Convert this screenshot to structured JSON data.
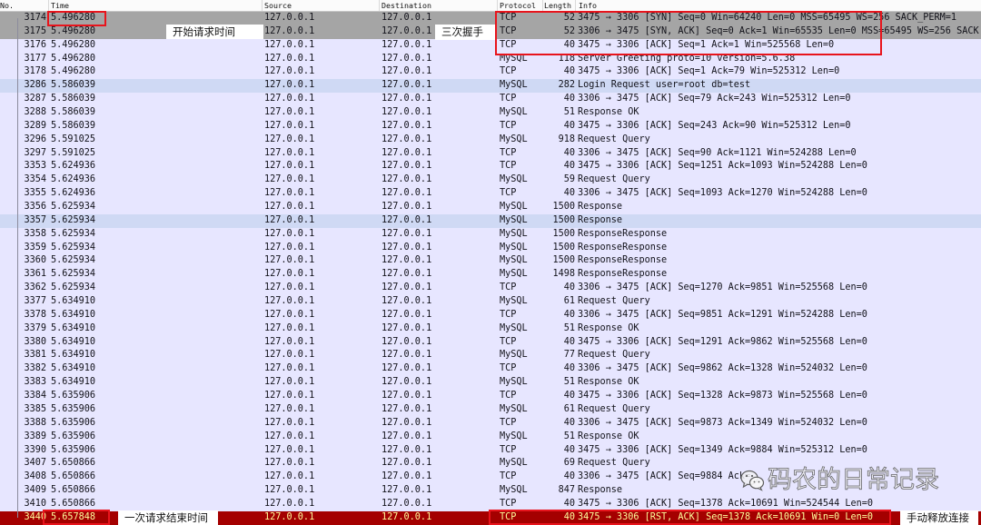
{
  "columns": {
    "no": "No.",
    "time": "Time",
    "source": "Source",
    "destination": "Destination",
    "protocol": "Protocol",
    "length": "Length",
    "info": "Info"
  },
  "row_styles": {
    "default": {
      "background": "#e7e6ff",
      "foreground": "#12121a"
    },
    "syn": {
      "background": "#a5a5a5",
      "foreground": "#12121a"
    },
    "highlight": {
      "background": "#cfd9f4",
      "foreground": "#12121a"
    },
    "rst": {
      "background": "#a40000",
      "foreground": "#fffc9c"
    }
  },
  "annotation_colors": {
    "box": "#e8141c",
    "label_background": "#ffffff"
  },
  "packets": [
    {
      "no": 3174,
      "time": "5.496280",
      "source": "127.0.0.1",
      "destination": "127.0.0.1",
      "protocol": "TCP",
      "length": 52,
      "info": "3475 → 3306 [SYN] Seq=0 Win=64240 Len=0 MSS=65495 WS=256 SACK_PERM=1",
      "style": "syn"
    },
    {
      "no": 3175,
      "time": "5.496280",
      "source": "127.0.0.1",
      "destination": "127.0.0.1",
      "protocol": "TCP",
      "length": 52,
      "info": "3306 → 3475 [SYN, ACK] Seq=0 Ack=1 Win=65535 Len=0 MSS=65495 WS=256 SACK",
      "style": "syn"
    },
    {
      "no": 3176,
      "time": "5.496280",
      "source": "127.0.0.1",
      "destination": "127.0.0.1",
      "protocol": "TCP",
      "length": 40,
      "info": "3475 → 3306 [ACK] Seq=1 Ack=1 Win=525568 Len=0",
      "style": "default"
    },
    {
      "no": 3177,
      "time": "5.496280",
      "source": "127.0.0.1",
      "destination": "127.0.0.1",
      "protocol": "MySQL",
      "length": 118,
      "info": "Server Greeting proto=10 version=5.6.38",
      "style": "default"
    },
    {
      "no": 3178,
      "time": "5.496280",
      "source": "127.0.0.1",
      "destination": "127.0.0.1",
      "protocol": "TCP",
      "length": 40,
      "info": "3475 → 3306 [ACK] Seq=1 Ack=79 Win=525312 Len=0",
      "style": "default"
    },
    {
      "no": 3286,
      "time": "5.586039",
      "source": "127.0.0.1",
      "destination": "127.0.0.1",
      "protocol": "MySQL",
      "length": 282,
      "info": "Login Request user=root db=test",
      "style": "highlight"
    },
    {
      "no": 3287,
      "time": "5.586039",
      "source": "127.0.0.1",
      "destination": "127.0.0.1",
      "protocol": "TCP",
      "length": 40,
      "info": "3306 → 3475 [ACK] Seq=79 Ack=243 Win=525312 Len=0",
      "style": "default"
    },
    {
      "no": 3288,
      "time": "5.586039",
      "source": "127.0.0.1",
      "destination": "127.0.0.1",
      "protocol": "MySQL",
      "length": 51,
      "info": "Response OK",
      "style": "default"
    },
    {
      "no": 3289,
      "time": "5.586039",
      "source": "127.0.0.1",
      "destination": "127.0.0.1",
      "protocol": "TCP",
      "length": 40,
      "info": "3475 → 3306 [ACK] Seq=243 Ack=90 Win=525312 Len=0",
      "style": "default"
    },
    {
      "no": 3296,
      "time": "5.591025",
      "source": "127.0.0.1",
      "destination": "127.0.0.1",
      "protocol": "MySQL",
      "length": 918,
      "info": "Request Query",
      "style": "default"
    },
    {
      "no": 3297,
      "time": "5.591025",
      "source": "127.0.0.1",
      "destination": "127.0.0.1",
      "protocol": "TCP",
      "length": 40,
      "info": "3306 → 3475 [ACK] Seq=90 Ack=1121 Win=524288 Len=0",
      "style": "default"
    },
    {
      "no": 3353,
      "time": "5.624936",
      "source": "127.0.0.1",
      "destination": "127.0.0.1",
      "protocol": "TCP",
      "length": 40,
      "info": "3475 → 3306 [ACK] Seq=1251 Ack=1093 Win=524288 Len=0",
      "style": "default"
    },
    {
      "no": 3354,
      "time": "5.624936",
      "source": "127.0.0.1",
      "destination": "127.0.0.1",
      "protocol": "MySQL",
      "length": 59,
      "info": "Request Query",
      "style": "default"
    },
    {
      "no": 3355,
      "time": "5.624936",
      "source": "127.0.0.1",
      "destination": "127.0.0.1",
      "protocol": "TCP",
      "length": 40,
      "info": "3306 → 3475 [ACK] Seq=1093 Ack=1270 Win=524288 Len=0",
      "style": "default"
    },
    {
      "no": 3356,
      "time": "5.625934",
      "source": "127.0.0.1",
      "destination": "127.0.0.1",
      "protocol": "MySQL",
      "length": 1500,
      "info": "Response",
      "style": "default"
    },
    {
      "no": 3357,
      "time": "5.625934",
      "source": "127.0.0.1",
      "destination": "127.0.0.1",
      "protocol": "MySQL",
      "length": 1500,
      "info": "Response",
      "style": "highlight"
    },
    {
      "no": 3358,
      "time": "5.625934",
      "source": "127.0.0.1",
      "destination": "127.0.0.1",
      "protocol": "MySQL",
      "length": 1500,
      "info": "ResponseResponse",
      "style": "default"
    },
    {
      "no": 3359,
      "time": "5.625934",
      "source": "127.0.0.1",
      "destination": "127.0.0.1",
      "protocol": "MySQL",
      "length": 1500,
      "info": "ResponseResponse",
      "style": "default"
    },
    {
      "no": 3360,
      "time": "5.625934",
      "source": "127.0.0.1",
      "destination": "127.0.0.1",
      "protocol": "MySQL",
      "length": 1500,
      "info": "ResponseResponse",
      "style": "default"
    },
    {
      "no": 3361,
      "time": "5.625934",
      "source": "127.0.0.1",
      "destination": "127.0.0.1",
      "protocol": "MySQL",
      "length": 1498,
      "info": "ResponseResponse",
      "style": "default"
    },
    {
      "no": 3362,
      "time": "5.625934",
      "source": "127.0.0.1",
      "destination": "127.0.0.1",
      "protocol": "TCP",
      "length": 40,
      "info": "3306 → 3475 [ACK] Seq=1270 Ack=9851 Win=525568 Len=0",
      "style": "default"
    },
    {
      "no": 3377,
      "time": "5.634910",
      "source": "127.0.0.1",
      "destination": "127.0.0.1",
      "protocol": "MySQL",
      "length": 61,
      "info": "Request Query",
      "style": "default"
    },
    {
      "no": 3378,
      "time": "5.634910",
      "source": "127.0.0.1",
      "destination": "127.0.0.1",
      "protocol": "TCP",
      "length": 40,
      "info": "3306 → 3475 [ACK] Seq=9851 Ack=1291 Win=524288 Len=0",
      "style": "default"
    },
    {
      "no": 3379,
      "time": "5.634910",
      "source": "127.0.0.1",
      "destination": "127.0.0.1",
      "protocol": "MySQL",
      "length": 51,
      "info": "Response OK",
      "style": "default"
    },
    {
      "no": 3380,
      "time": "5.634910",
      "source": "127.0.0.1",
      "destination": "127.0.0.1",
      "protocol": "TCP",
      "length": 40,
      "info": "3475 → 3306 [ACK] Seq=1291 Ack=9862 Win=525568 Len=0",
      "style": "default"
    },
    {
      "no": 3381,
      "time": "5.634910",
      "source": "127.0.0.1",
      "destination": "127.0.0.1",
      "protocol": "MySQL",
      "length": 77,
      "info": "Request Query",
      "style": "default"
    },
    {
      "no": 3382,
      "time": "5.634910",
      "source": "127.0.0.1",
      "destination": "127.0.0.1",
      "protocol": "TCP",
      "length": 40,
      "info": "3306 → 3475 [ACK] Seq=9862 Ack=1328 Win=524032 Len=0",
      "style": "default"
    },
    {
      "no": 3383,
      "time": "5.634910",
      "source": "127.0.0.1",
      "destination": "127.0.0.1",
      "protocol": "MySQL",
      "length": 51,
      "info": "Response OK",
      "style": "default"
    },
    {
      "no": 3384,
      "time": "5.635906",
      "source": "127.0.0.1",
      "destination": "127.0.0.1",
      "protocol": "TCP",
      "length": 40,
      "info": "3475 → 3306 [ACK] Seq=1328 Ack=9873 Win=525568 Len=0",
      "style": "default"
    },
    {
      "no": 3385,
      "time": "5.635906",
      "source": "127.0.0.1",
      "destination": "127.0.0.1",
      "protocol": "MySQL",
      "length": 61,
      "info": "Request Query",
      "style": "default"
    },
    {
      "no": 3388,
      "time": "5.635906",
      "source": "127.0.0.1",
      "destination": "127.0.0.1",
      "protocol": "TCP",
      "length": 40,
      "info": "3306 → 3475 [ACK] Seq=9873 Ack=1349 Win=524032 Len=0",
      "style": "default"
    },
    {
      "no": 3389,
      "time": "5.635906",
      "source": "127.0.0.1",
      "destination": "127.0.0.1",
      "protocol": "MySQL",
      "length": 51,
      "info": "Response OK",
      "style": "default"
    },
    {
      "no": 3390,
      "time": "5.635906",
      "source": "127.0.0.1",
      "destination": "127.0.0.1",
      "protocol": "TCP",
      "length": 40,
      "info": "3475 → 3306 [ACK] Seq=1349 Ack=9884 Win=525312 Len=0",
      "style": "default"
    },
    {
      "no": 3407,
      "time": "5.650866",
      "source": "127.0.0.1",
      "destination": "127.0.0.1",
      "protocol": "MySQL",
      "length": 69,
      "info": "Request Query",
      "style": "default"
    },
    {
      "no": 3408,
      "time": "5.650866",
      "source": "127.0.0.1",
      "destination": "127.0.0.1",
      "protocol": "TCP",
      "length": 40,
      "info": "3306 → 3475 [ACK] Seq=9884 Ack=",
      "style": "default"
    },
    {
      "no": 3409,
      "time": "5.650866",
      "source": "127.0.0.1",
      "destination": "127.0.0.1",
      "protocol": "MySQL",
      "length": 847,
      "info": "Response",
      "style": "default"
    },
    {
      "no": 3410,
      "time": "5.650866",
      "source": "127.0.0.1",
      "destination": "127.0.0.1",
      "protocol": "TCP",
      "length": 40,
      "info": "3475 → 3306 [ACK] Seq=1378 Ack=10691 Win=524544 Len=0",
      "style": "default"
    },
    {
      "no": 3440,
      "time": "5.657848",
      "source": "127.0.0.1",
      "destination": "127.0.0.1",
      "protocol": "TCP",
      "length": 40,
      "info": "3475 → 3306 [RST, ACK] Seq=1378 Ack=10691 Win=0 Len=0",
      "style": "rst"
    }
  ],
  "annotations": {
    "start_time_label": "开始请求时间",
    "handshake_label": "三次握手",
    "end_time_label": "一次请求结束时间",
    "release_label": "手动释放连接"
  },
  "watermark": {
    "icon": "wechat-icon",
    "text": "码农的日常记录"
  }
}
